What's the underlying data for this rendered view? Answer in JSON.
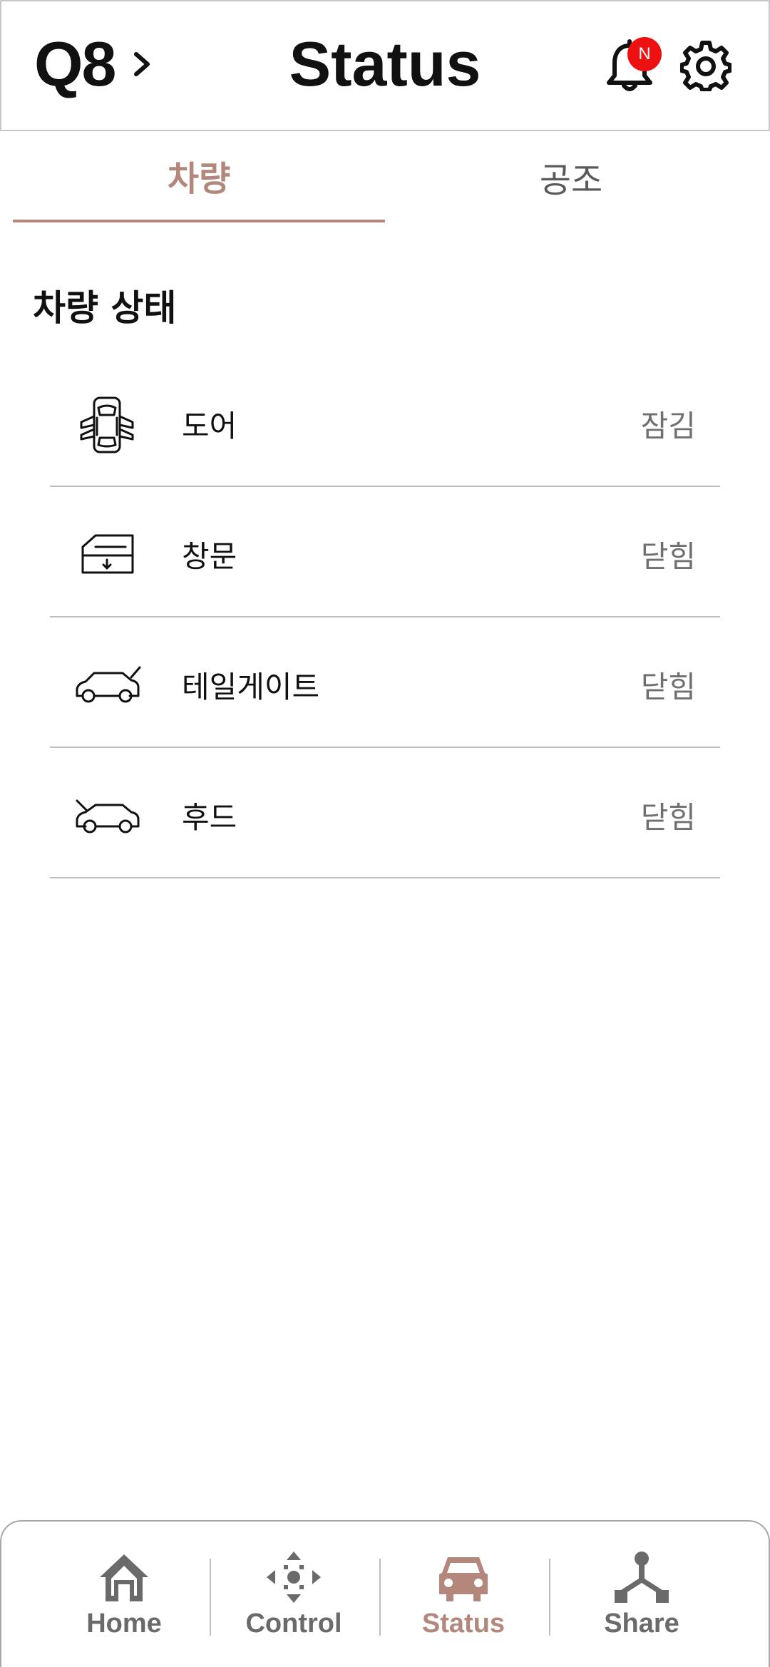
{
  "header": {
    "vehicle_name": "Q8",
    "title": "Status",
    "notification_badge": "N"
  },
  "tabs": [
    {
      "label": "차량",
      "active": true
    },
    {
      "label": "공조",
      "active": false
    }
  ],
  "section_title": "차량 상태",
  "status_items": [
    {
      "icon": "car-doors-open-icon",
      "label": "도어",
      "value": "잠김"
    },
    {
      "icon": "car-window-icon",
      "label": "창문",
      "value": "닫힘"
    },
    {
      "icon": "car-tailgate-icon",
      "label": "테일게이트",
      "value": "닫힘"
    },
    {
      "icon": "car-hood-icon",
      "label": "후드",
      "value": "닫힘"
    }
  ],
  "bottom_nav": [
    {
      "icon": "home-icon",
      "label": "Home",
      "active": false
    },
    {
      "icon": "control-dpad-icon",
      "label": "Control",
      "active": false
    },
    {
      "icon": "car-icon",
      "label": "Status",
      "active": true
    },
    {
      "icon": "share-icon",
      "label": "Share",
      "active": false
    }
  ],
  "colors": {
    "accent": "#b3877b",
    "badge": "#ee1111",
    "inactive": "#6a6a6a",
    "divider": "#bdbdbd"
  }
}
